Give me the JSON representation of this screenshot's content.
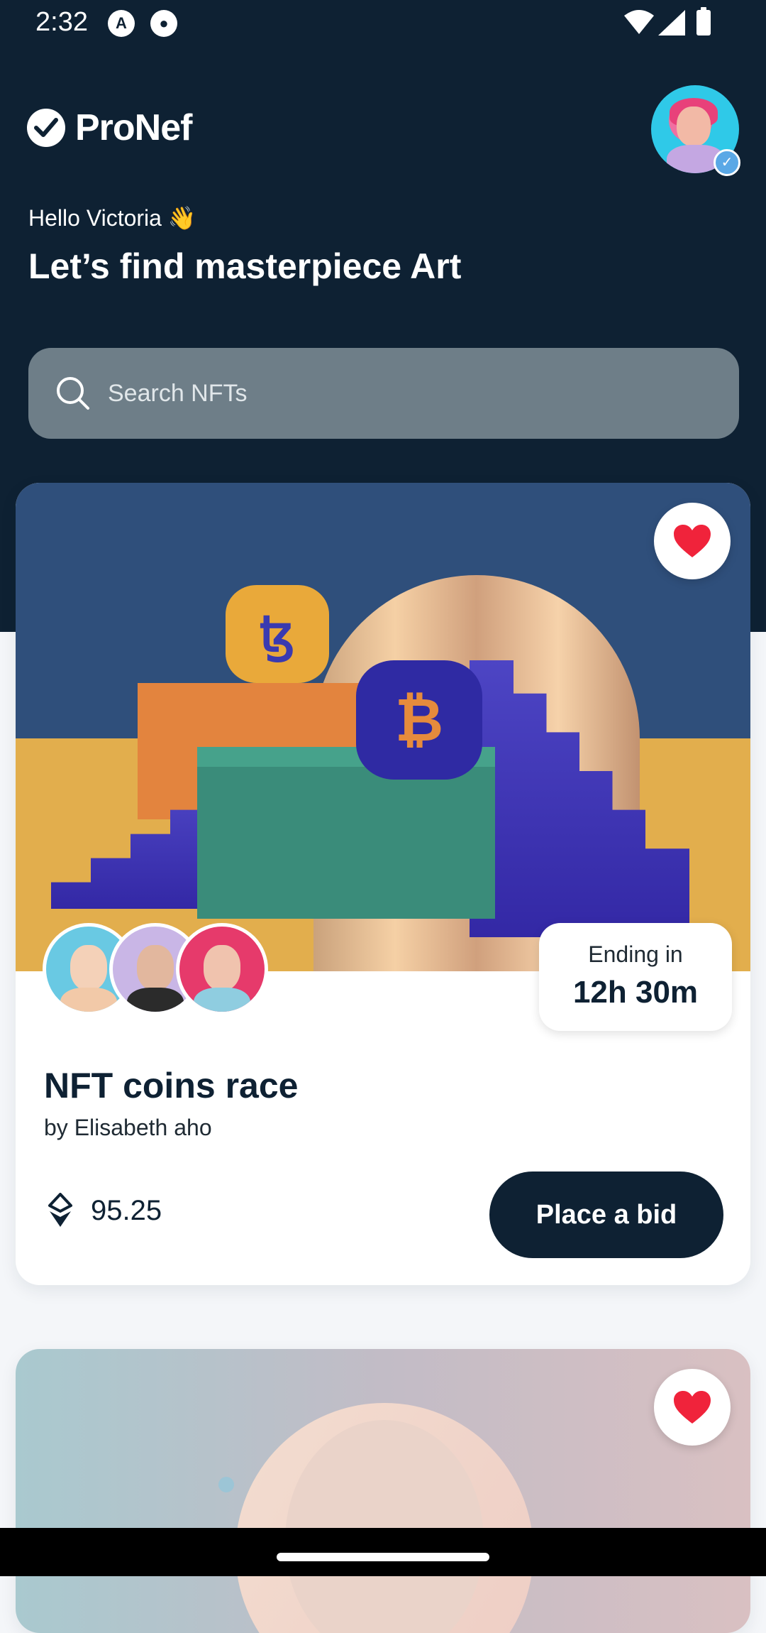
{
  "status_bar": {
    "time": "2:32"
  },
  "header": {
    "brand": "ProNef",
    "greeting": "Hello Victoria 👋",
    "headline": "Let’s find masterpiece Art"
  },
  "search": {
    "placeholder": "Search NFTs"
  },
  "cards": [
    {
      "ending_label": "Ending in",
      "ending_value": "12h 30m",
      "title": "NFT coins race",
      "author": "by Elisabeth aho",
      "price": "95.25",
      "bid_label": "Place a bid",
      "favorite": true
    },
    {
      "favorite": true
    }
  ],
  "colors": {
    "primary": "#0e2133",
    "search_bg": "#6e7e88",
    "favorite": "#f0233b"
  }
}
